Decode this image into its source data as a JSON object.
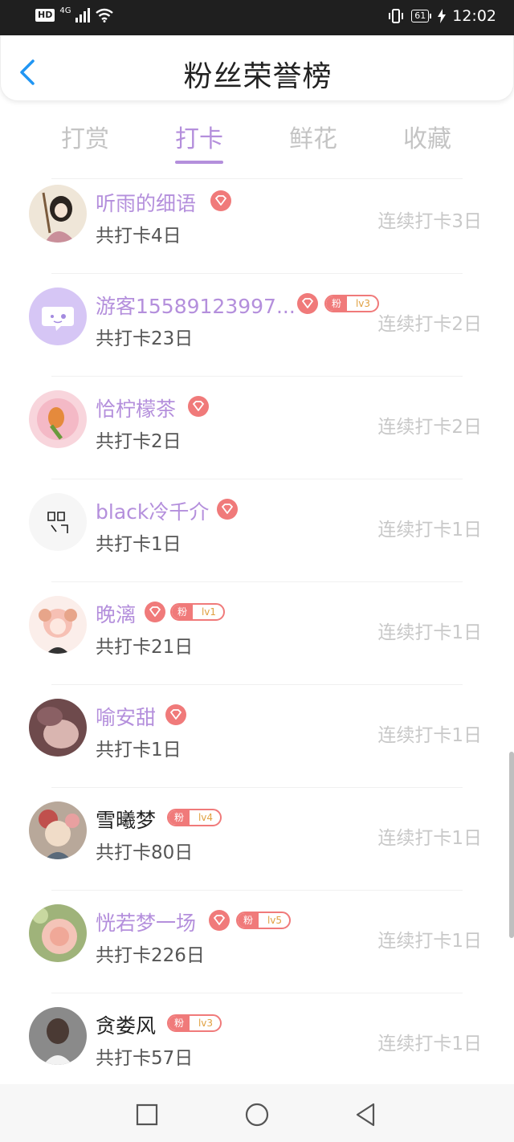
{
  "status_bar": {
    "hd": "HD",
    "network": "4G",
    "battery": "61",
    "time": "12:02"
  },
  "header": {
    "title": "粉丝荣誉榜"
  },
  "tabs": [
    {
      "label": "打赏",
      "active": false
    },
    {
      "label": "打卡",
      "active": true
    },
    {
      "label": "鲜花",
      "active": false
    },
    {
      "label": "收藏",
      "active": false
    }
  ],
  "fans": [
    {
      "name": "听雨的细语",
      "total": "共打卡4日",
      "streak": "连续打卡3日",
      "name_color": "purple",
      "gem": true,
      "fan_level": null
    },
    {
      "name": "游客15589123997...",
      "total": "共打卡23日",
      "streak": "连续打卡2日",
      "name_color": "purple",
      "gem": true,
      "fan_level": "lv3"
    },
    {
      "name": "恰柠檬茶",
      "total": "共打卡2日",
      "streak": "连续打卡2日",
      "name_color": "purple",
      "gem": true,
      "fan_level": null
    },
    {
      "name": "black冷千介",
      "total": "共打卡1日",
      "streak": "连续打卡1日",
      "name_color": "purple",
      "gem": true,
      "fan_level": null
    },
    {
      "name": "晚漓",
      "total": "共打卡21日",
      "streak": "连续打卡1日",
      "name_color": "purple",
      "gem": true,
      "fan_level": "lv1"
    },
    {
      "name": "喻安甜",
      "total": "共打卡1日",
      "streak": "连续打卡1日",
      "name_color": "purple",
      "gem": true,
      "fan_level": null
    },
    {
      "name": "雪曦梦",
      "total": "共打卡80日",
      "streak": "连续打卡1日",
      "name_color": "dark",
      "gem": false,
      "fan_level": "lv4"
    },
    {
      "name": "恍若梦一场",
      "total": "共打卡226日",
      "streak": "连续打卡1日",
      "name_color": "purple",
      "gem": true,
      "fan_level": "lv5"
    },
    {
      "name": "贪娄风",
      "total": "共打卡57日",
      "streak": "连续打卡1日",
      "name_color": "dark",
      "gem": false,
      "fan_level": "lv3"
    }
  ],
  "fan_badge_label": "粉",
  "colors": {
    "accent": "#b48fdc",
    "badge": "#f07a7a",
    "level": "#e0a040"
  },
  "icons": {
    "back": "chevron-left-icon",
    "gem": "diamond-icon",
    "nav_recent": "square-icon",
    "nav_home": "circle-icon",
    "nav_back": "triangle-back-icon"
  }
}
